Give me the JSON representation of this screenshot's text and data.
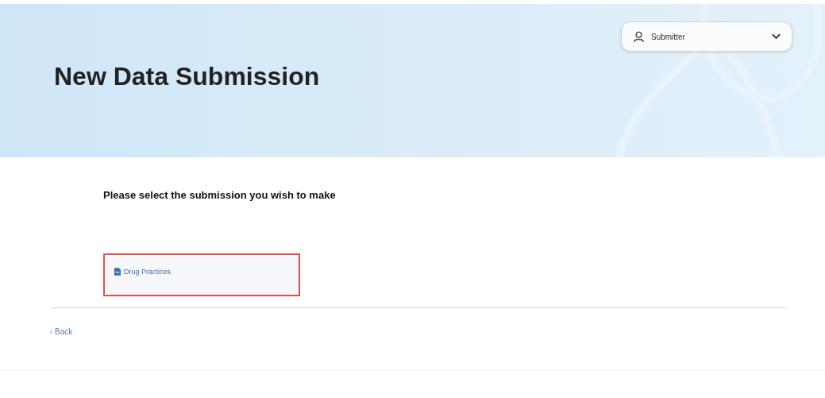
{
  "header": {
    "title": "New Data Submission",
    "user_menu": {
      "label": "Submitter"
    }
  },
  "prompt": "Please select the submission you wish to make",
  "options": [
    {
      "label": "Drug Practices",
      "selected": true
    }
  ],
  "back": {
    "icon": "‹",
    "label": "Back"
  }
}
